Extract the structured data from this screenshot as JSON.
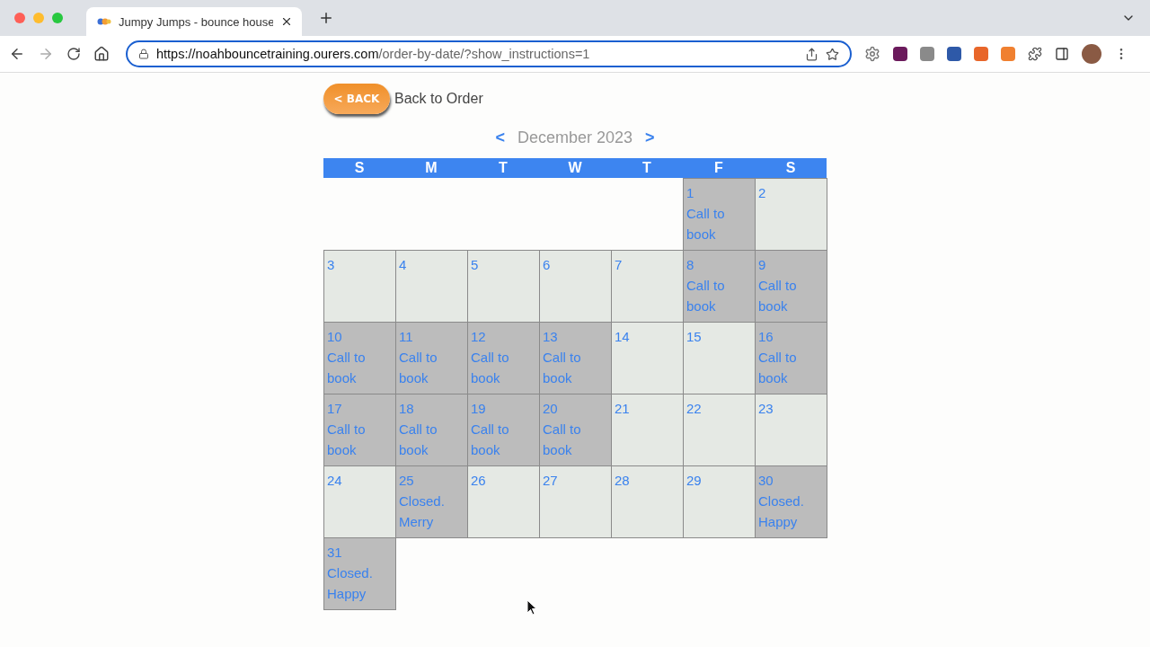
{
  "browser": {
    "tab": {
      "title": "Jumpy Jumps - bounce house"
    },
    "url": {
      "host": "https://noahbouncetraining.ourers.com",
      "path": "/order-by-date/?show_instructions=1"
    }
  },
  "header": {
    "back_button": "< BACK",
    "back_label": "Back to Order"
  },
  "calendar": {
    "prev": "<",
    "month": "December 2023",
    "next": ">",
    "weekdays": [
      "S",
      "M",
      "T",
      "W",
      "T",
      "F",
      "S"
    ],
    "days": [
      {
        "kind": "blank"
      },
      {
        "kind": "blank"
      },
      {
        "kind": "blank"
      },
      {
        "kind": "blank"
      },
      {
        "kind": "blank"
      },
      {
        "kind": "day",
        "day": "1",
        "note": "Call to book",
        "unavailable": true
      },
      {
        "kind": "day",
        "day": "2",
        "unavailable": false
      },
      {
        "kind": "day",
        "day": "3",
        "unavailable": false
      },
      {
        "kind": "day",
        "day": "4",
        "unavailable": false
      },
      {
        "kind": "day",
        "day": "5",
        "unavailable": false
      },
      {
        "kind": "day",
        "day": "6",
        "unavailable": false
      },
      {
        "kind": "day",
        "day": "7",
        "unavailable": false
      },
      {
        "kind": "day",
        "day": "8",
        "note": "Call to book",
        "unavailable": true
      },
      {
        "kind": "day",
        "day": "9",
        "note": "Call to book",
        "unavailable": true
      },
      {
        "kind": "day",
        "day": "10",
        "note": "Call to book",
        "unavailable": true
      },
      {
        "kind": "day",
        "day": "11",
        "note": "Call to book",
        "unavailable": true
      },
      {
        "kind": "day",
        "day": "12",
        "note": "Call to book",
        "unavailable": true
      },
      {
        "kind": "day",
        "day": "13",
        "note": "Call to book",
        "unavailable": true
      },
      {
        "kind": "day",
        "day": "14",
        "unavailable": false
      },
      {
        "kind": "day",
        "day": "15",
        "unavailable": false
      },
      {
        "kind": "day",
        "day": "16",
        "note": "Call to book",
        "unavailable": true
      },
      {
        "kind": "day",
        "day": "17",
        "note": "Call to book",
        "unavailable": true
      },
      {
        "kind": "day",
        "day": "18",
        "note": "Call to book",
        "unavailable": true
      },
      {
        "kind": "day",
        "day": "19",
        "note": "Call to book",
        "unavailable": true
      },
      {
        "kind": "day",
        "day": "20",
        "note": "Call to book",
        "unavailable": true
      },
      {
        "kind": "day",
        "day": "21",
        "unavailable": false
      },
      {
        "kind": "day",
        "day": "22",
        "unavailable": false
      },
      {
        "kind": "day",
        "day": "23",
        "unavailable": false
      },
      {
        "kind": "day",
        "day": "24",
        "unavailable": false
      },
      {
        "kind": "day",
        "day": "25",
        "note": "Closed. Merry",
        "unavailable": true
      },
      {
        "kind": "day",
        "day": "26",
        "unavailable": false
      },
      {
        "kind": "day",
        "day": "27",
        "unavailable": false
      },
      {
        "kind": "day",
        "day": "28",
        "unavailable": false
      },
      {
        "kind": "day",
        "day": "29",
        "unavailable": false
      },
      {
        "kind": "day",
        "day": "30",
        "note": "Closed. Happy",
        "unavailable": true
      },
      {
        "kind": "day",
        "day": "31",
        "note": "Closed. Happy",
        "unavailable": true
      }
    ]
  }
}
